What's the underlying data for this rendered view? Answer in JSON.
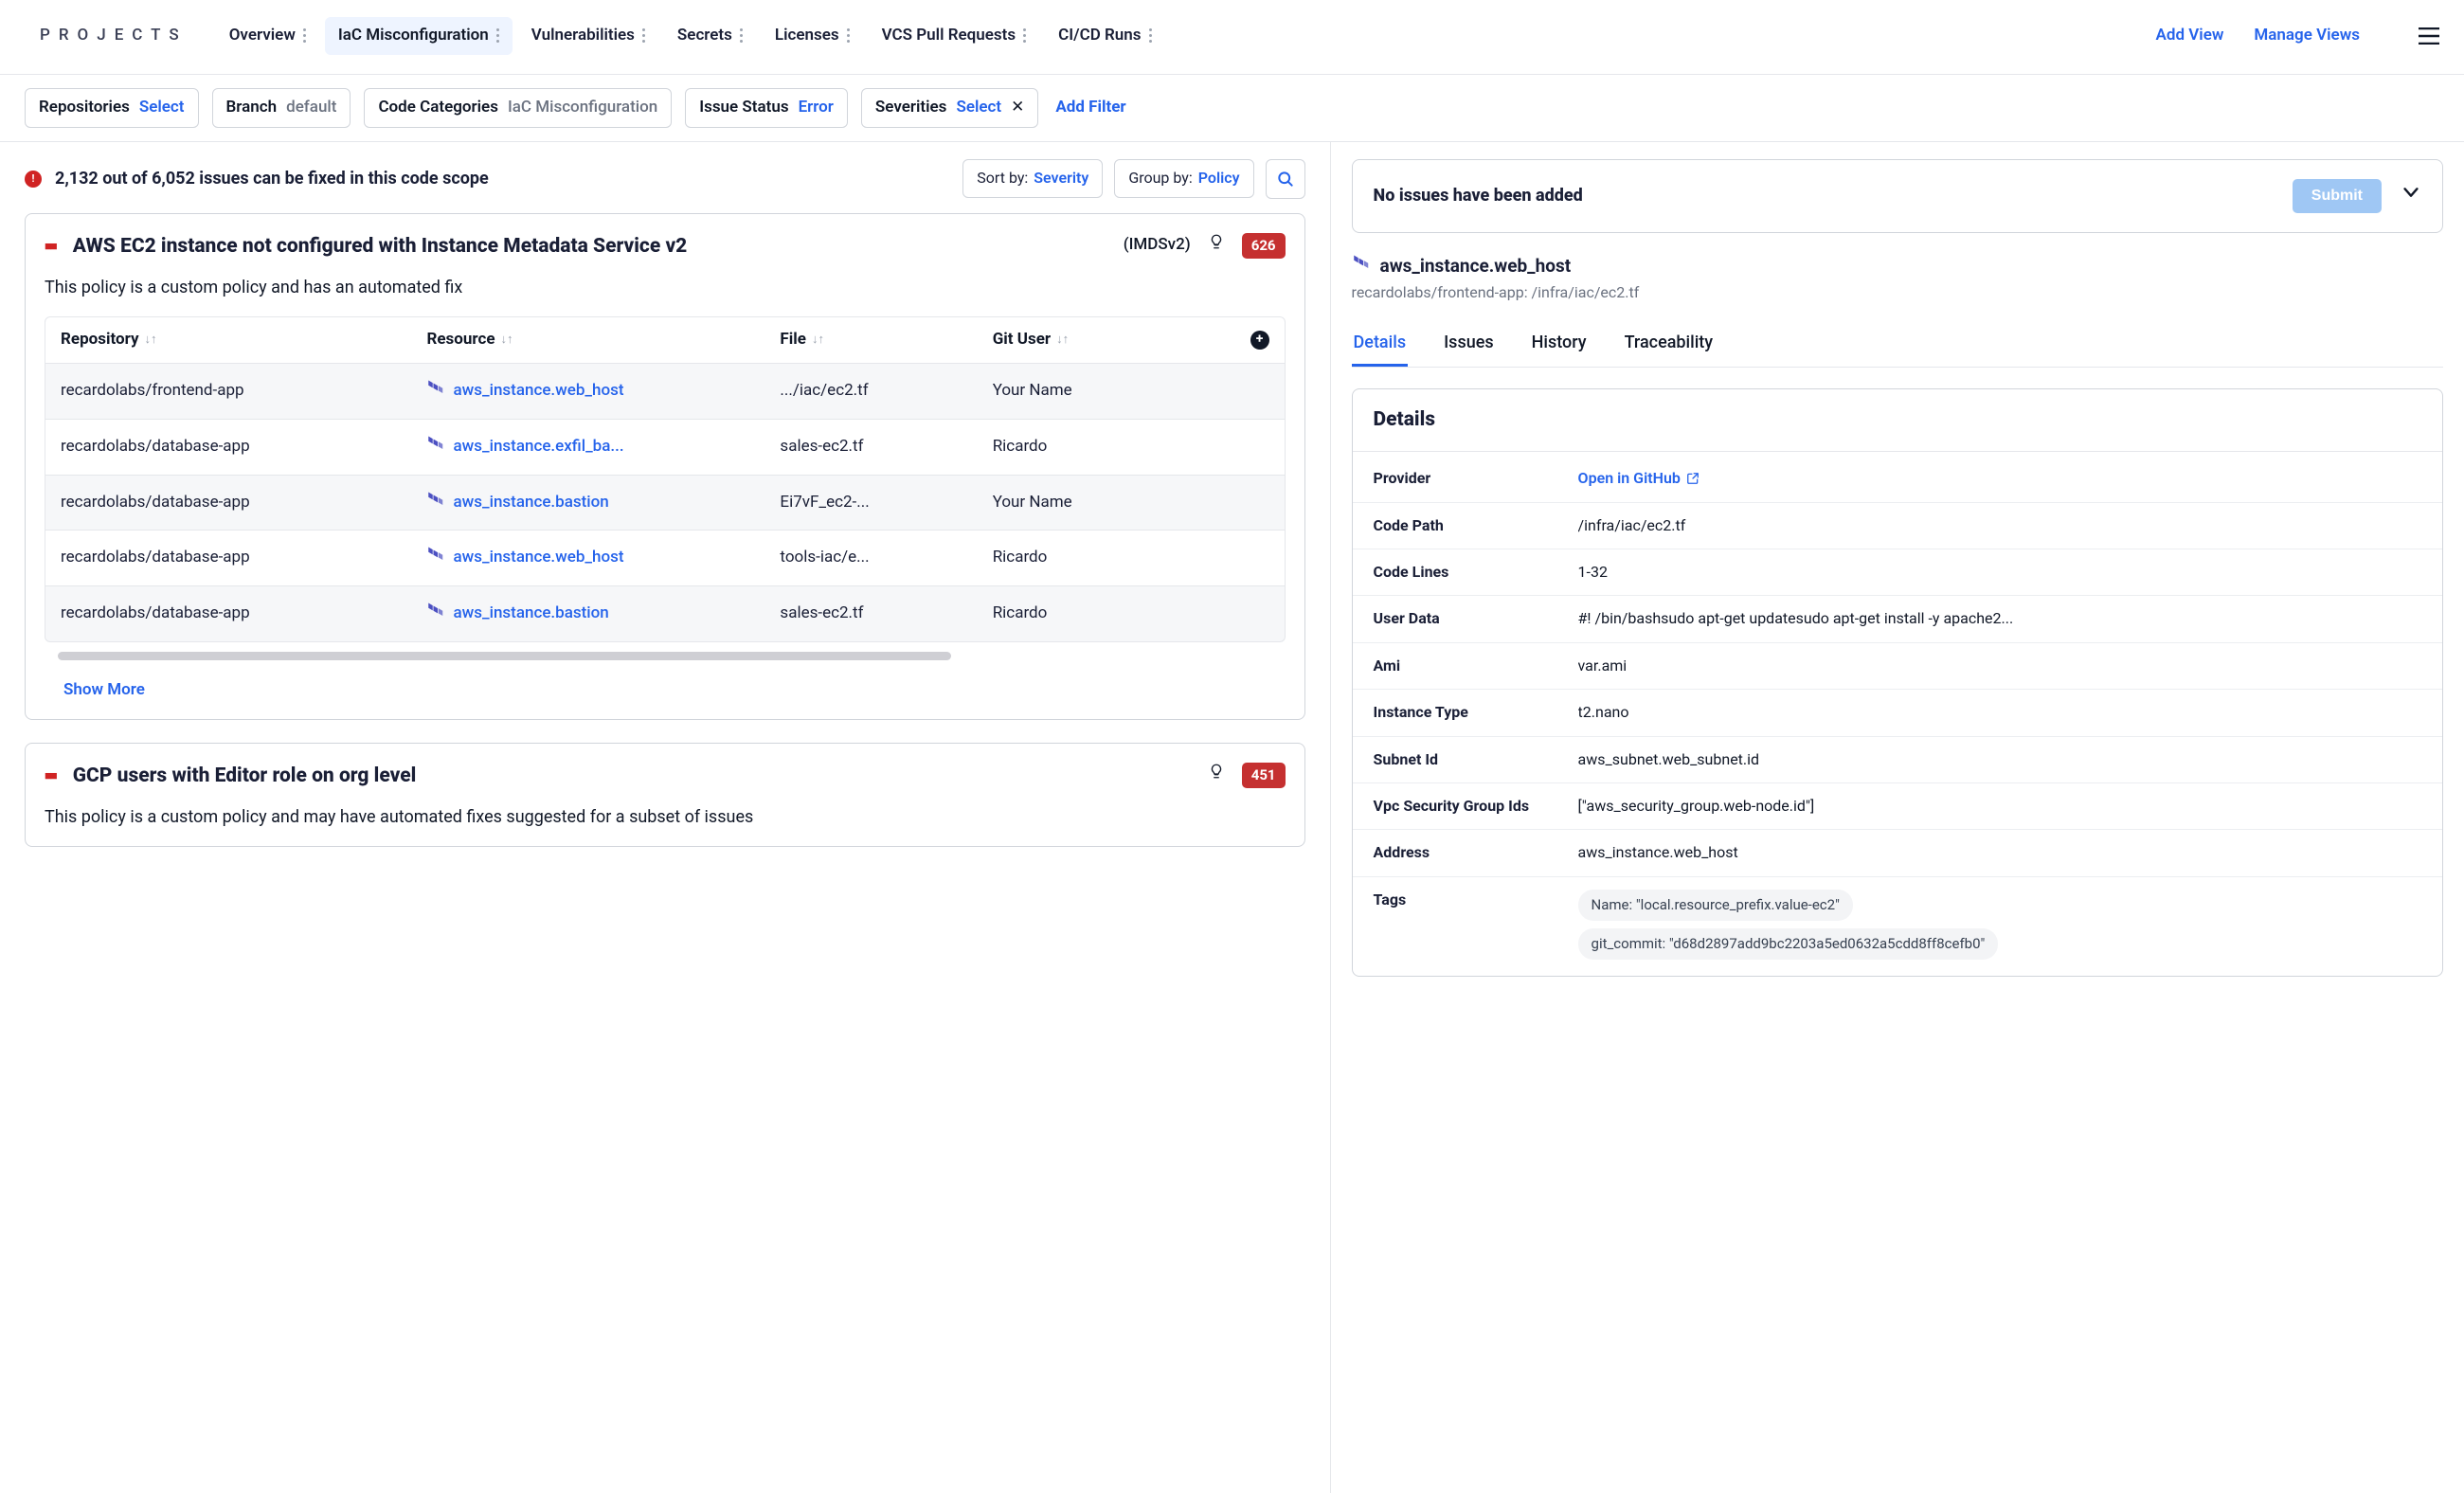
{
  "brand": "PROJECTS",
  "nav": {
    "tabs": [
      {
        "label": "Overview",
        "active": false
      },
      {
        "label": "IaC Misconfiguration",
        "active": true
      },
      {
        "label": "Vulnerabilities",
        "active": false
      },
      {
        "label": "Secrets",
        "active": false
      },
      {
        "label": "Licenses",
        "active": false
      },
      {
        "label": "VCS Pull Requests",
        "active": false
      },
      {
        "label": "CI/CD Runs",
        "active": false
      }
    ],
    "add_view": "Add View",
    "manage_views": "Manage Views"
  },
  "filters": {
    "items": [
      {
        "label": "Repositories",
        "value": "Select",
        "value_style": "blue",
        "closable": false
      },
      {
        "label": "Branch",
        "value": "default",
        "value_style": "mut",
        "closable": false
      },
      {
        "label": "Code Categories",
        "value": "IaC Misconfiguration",
        "value_style": "mut",
        "closable": false
      },
      {
        "label": "Issue Status",
        "value": "Error",
        "value_style": "blue",
        "closable": false
      },
      {
        "label": "Severities",
        "value": "Select",
        "value_style": "blue",
        "closable": true
      }
    ],
    "add_filter": "Add Filter"
  },
  "scope": {
    "text": "2,132 out of 6,052 issues can be fixed in this code scope",
    "sort_label": "Sort by:",
    "sort_value": "Severity",
    "group_label": "Group by:",
    "group_value": "Policy"
  },
  "policies": [
    {
      "title": "AWS EC2 instance not configured with Instance Metadata Service v2",
      "paren": "(IMDSv2)",
      "count": "626",
      "desc": "This policy is a custom policy and has an automated fix",
      "columns": [
        "Repository",
        "Resource",
        "File",
        "Git User"
      ],
      "rows": [
        {
          "repo": "recardolabs/frontend-app",
          "resource": "aws_instance.web_host",
          "file": ".../iac/ec2.tf",
          "user": "Your Name"
        },
        {
          "repo": "recardolabs/database-app",
          "resource": "aws_instance.exfil_ba...",
          "file": "sales-ec2.tf",
          "user": "Ricardo"
        },
        {
          "repo": "recardolabs/database-app",
          "resource": "aws_instance.bastion",
          "file": "Ei7vF_ec2-...",
          "user": "Your Name"
        },
        {
          "repo": "recardolabs/database-app",
          "resource": "aws_instance.web_host",
          "file": "tools-iac/e...",
          "user": "Ricardo"
        },
        {
          "repo": "recardolabs/database-app",
          "resource": "aws_instance.bastion",
          "file": "sales-ec2.tf",
          "user": "Ricardo"
        }
      ],
      "show_more": "Show More"
    },
    {
      "title": "GCP users with Editor role on org level",
      "paren": "",
      "count": "451",
      "desc": "This policy is a custom policy and may have automated fixes suggested for a subset of issues"
    }
  ],
  "right": {
    "no_issues": "No issues have been added",
    "submit": "Submit",
    "resource_name": "aws_instance.web_host",
    "resource_path": "recardolabs/frontend-app: /infra/iac/ec2.tf",
    "tabs": [
      "Details",
      "Issues",
      "History",
      "Traceability"
    ],
    "details_title": "Details",
    "provider_link": "Open in GitHub",
    "rows": [
      {
        "k": "Provider",
        "type": "link"
      },
      {
        "k": "Code Path",
        "v": "/infra/iac/ec2.tf"
      },
      {
        "k": "Code Lines",
        "v": "1-32"
      },
      {
        "k": "User Data",
        "v": "#! /bin/bashsudo apt-get updatesudo apt-get install -y apache2..."
      },
      {
        "k": "Ami",
        "v": "var.ami"
      },
      {
        "k": "Instance Type",
        "v": "t2.nano"
      },
      {
        "k": "Subnet Id",
        "v": "aws_subnet.web_subnet.id"
      },
      {
        "k": "Vpc Security Group Ids",
        "v": "[\"aws_security_group.web-node.id\"]"
      },
      {
        "k": "Address",
        "v": "aws_instance.web_host"
      }
    ],
    "tags_label": "Tags",
    "tags": [
      "Name: \"local.resource_prefix.value-ec2\"",
      "git_commit: \"d68d2897add9bc2203a5ed0632a5cdd8ff8cefb0\""
    ]
  }
}
